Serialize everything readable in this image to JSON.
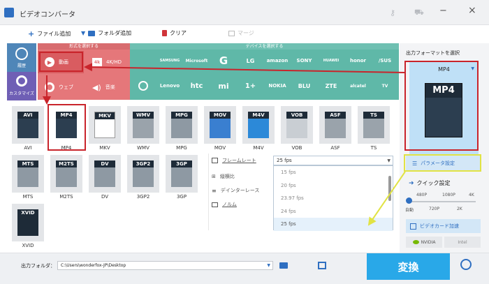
{
  "window": {
    "title": "ビデオコンバータ"
  },
  "toolbar": {
    "add_file": "ファイル追加",
    "add_folder": "フォルダ追加",
    "clear": "クリア",
    "merge": "マージ"
  },
  "left_tabs": {
    "history": "履歴",
    "customize": "カスタマイズ"
  },
  "categories": {
    "format_header": "形式を選択する",
    "device_header": "デバイスを選択する",
    "video": "動画",
    "4k": "4K/HD",
    "web": "ウェブ",
    "audio": "音楽"
  },
  "devices_row1": [
    "",
    "SAMSUNG",
    "Microsoft",
    "G",
    "LG",
    "amazon",
    "SONY",
    "HUAWEI",
    "honor",
    "/SUS"
  ],
  "devices_row2": [
    "",
    "Lenovo",
    "htc",
    "mi",
    "1+",
    "NOKIA",
    "BLU",
    "ZTE",
    "alcatel",
    "TV"
  ],
  "formats": [
    {
      "name": "AVI",
      "label": "AVI"
    },
    {
      "name": "MP4",
      "label": "MP4"
    },
    {
      "name": "MKV",
      "label": "MKV"
    },
    {
      "name": "WMV",
      "label": "WMV"
    },
    {
      "name": "MPG",
      "label": "MPG"
    },
    {
      "name": "MOV",
      "label": "MOV"
    },
    {
      "name": "M4V",
      "label": "M4V"
    },
    {
      "name": "VOB",
      "label": "VOB"
    },
    {
      "name": "ASF",
      "label": "ASF"
    },
    {
      "name": "TS",
      "label": "TS"
    },
    {
      "name": "MTS",
      "label": "MTS"
    },
    {
      "name": "M2TS",
      "label": "M2TS"
    },
    {
      "name": "DV",
      "label": "DV"
    },
    {
      "name": "3GP2",
      "label": "3GP2"
    },
    {
      "name": "3GP",
      "label": "3GP"
    },
    {
      "name": "XVID",
      "label": "XVID"
    }
  ],
  "params": {
    "framerate": "フレームレート",
    "aspect": "縦横比",
    "deinterlace": "デインターレース",
    "norm": "ノルム",
    "framerate_value": "25 fps",
    "options": [
      "15 fps",
      "20 fps",
      "23.97 fps",
      "24 fps",
      "25 fps"
    ]
  },
  "right": {
    "output_format_label": "出力フォーマットを選択",
    "selected": "MP4",
    "param_button": "パラメータ設定",
    "quick": "クイック設定",
    "quality_top": [
      "480P",
      "1080P",
      "4K"
    ],
    "quality_bottom": [
      "自動",
      "720P",
      "2K"
    ],
    "gpu": "ビデオカード加速",
    "nvidia": "NVIDIA",
    "intel": "Intel"
  },
  "bottom": {
    "folder_label": "出力フォルダ：",
    "folder_path": "C:\\Users\\wonderfox-JP\\Desktop",
    "convert": "変換"
  }
}
